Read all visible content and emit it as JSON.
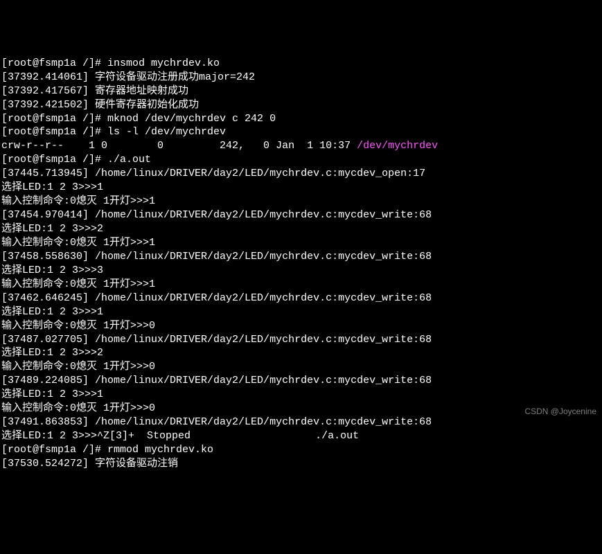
{
  "lines": [
    {
      "segments": [
        {
          "t": "[root@fsmp1a /]# insmod mychrdev.ko"
        }
      ]
    },
    {
      "segments": [
        {
          "t": "[37392.414061] 字符设备驱动注册成功major=242"
        }
      ]
    },
    {
      "segments": [
        {
          "t": "[37392.417567] 寄存器地址映射成功"
        }
      ]
    },
    {
      "segments": [
        {
          "t": "[37392.421502] 硬件寄存器初始化成功"
        }
      ]
    },
    {
      "segments": [
        {
          "t": "[root@fsmp1a /]# mknod /dev/mychrdev c 242 0"
        }
      ]
    },
    {
      "segments": [
        {
          "t": "[root@fsmp1a /]# ls -l /dev/mychrdev"
        }
      ]
    },
    {
      "segments": [
        {
          "t": "crw-r--r--    1 0        0         242,   0 Jan  1 10:37 "
        },
        {
          "t": "/dev/mychrdev",
          "c": "magenta"
        }
      ]
    },
    {
      "segments": [
        {
          "t": "[root@fsmp1a /]# ./a.out"
        }
      ]
    },
    {
      "segments": [
        {
          "t": "[37445.713945] /home/linux/DRIVER/day2/LED/mychrdev.c:mycdev_open:17"
        }
      ]
    },
    {
      "segments": [
        {
          "t": "选择LED:1 2 3>>>1"
        }
      ]
    },
    {
      "segments": [
        {
          "t": "输入控制命令:0熄灭 1开灯>>>1"
        }
      ]
    },
    {
      "segments": [
        {
          "t": "[37454.970414] /home/linux/DRIVER/day2/LED/mychrdev.c:mycdev_write:68"
        }
      ]
    },
    {
      "segments": [
        {
          "t": "选择LED:1 2 3>>>2"
        }
      ]
    },
    {
      "segments": [
        {
          "t": "输入控制命令:0熄灭 1开灯>>>1"
        }
      ]
    },
    {
      "segments": [
        {
          "t": "[37458.558630] /home/linux/DRIVER/day2/LED/mychrdev.c:mycdev_write:68"
        }
      ]
    },
    {
      "segments": [
        {
          "t": "选择LED:1 2 3>>>3"
        }
      ]
    },
    {
      "segments": [
        {
          "t": "输入控制命令:0熄灭 1开灯>>>1"
        }
      ]
    },
    {
      "segments": [
        {
          "t": "[37462.646245] /home/linux/DRIVER/day2/LED/mychrdev.c:mycdev_write:68"
        }
      ]
    },
    {
      "segments": [
        {
          "t": "选择LED:1 2 3>>>1"
        }
      ]
    },
    {
      "segments": [
        {
          "t": "输入控制命令:0熄灭 1开灯>>>0"
        }
      ]
    },
    {
      "segments": [
        {
          "t": "[37487.027705] /home/linux/DRIVER/day2/LED/mychrdev.c:mycdev_write:68"
        }
      ]
    },
    {
      "segments": [
        {
          "t": "选择LED:1 2 3>>>2"
        }
      ]
    },
    {
      "segments": [
        {
          "t": "输入控制命令:0熄灭 1开灯>>>0"
        }
      ]
    },
    {
      "segments": [
        {
          "t": "[37489.224085] /home/linux/DRIVER/day2/LED/mychrdev.c:mycdev_write:68"
        }
      ]
    },
    {
      "segments": [
        {
          "t": "选择LED:1 2 3>>>1"
        }
      ]
    },
    {
      "segments": [
        {
          "t": "输入控制命令:0熄灭 1开灯>>>0"
        }
      ]
    },
    {
      "segments": [
        {
          "t": "[37491.863853] /home/linux/DRIVER/day2/LED/mychrdev.c:mycdev_write:68"
        }
      ]
    },
    {
      "segments": [
        {
          "t": "选择LED:1 2 3>>>^Z[3]+  Stopped                    ./a.out"
        }
      ]
    },
    {
      "segments": [
        {
          "t": "[root@fsmp1a /]# rmmod mychrdev.ko"
        }
      ]
    },
    {
      "segments": [
        {
          "t": "[37530.524272] 字符设备驱动注销"
        }
      ]
    }
  ],
  "watermark": "CSDN @Joycenine"
}
